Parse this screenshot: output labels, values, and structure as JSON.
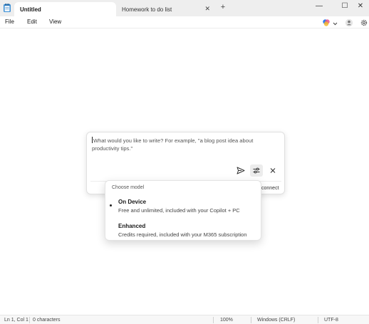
{
  "tabs": [
    {
      "label": "Untitled",
      "active": true
    },
    {
      "label": "Homework to do list",
      "active": false
    }
  ],
  "window_controls": {
    "minimize": "—",
    "maximize": "☐",
    "close": "✕"
  },
  "menu": {
    "file": "File",
    "edit": "Edit",
    "view": "View"
  },
  "write_panel": {
    "prompt_placeholder": "What would you like to write? For example, \"a blog post idea about productivity tips.\"",
    "reconnect_label": "connect"
  },
  "model_menu": {
    "title": "Choose model",
    "options": [
      {
        "label": "On Device",
        "description": "Free and unlimited, included with your Copilot + PC",
        "selected": true
      },
      {
        "label": "Enhanced",
        "description": "Credits required, included with your M365 subscription",
        "selected": false
      }
    ]
  },
  "status": {
    "position": "Ln 1, Col 1",
    "characters": "0 characters",
    "zoom": "100%",
    "line_ending": "Windows (CRLF)",
    "encoding": "UTF-8"
  },
  "icons": {
    "app": "notepad-icon",
    "copilot": "copilot-icon",
    "account": "account-icon",
    "settings": "gear-icon",
    "send": "send-icon",
    "model_settings": "sliders-icon",
    "close": "close-icon"
  },
  "colors": {
    "accent": "#0067c0",
    "titlebar": "#eeeeee"
  }
}
